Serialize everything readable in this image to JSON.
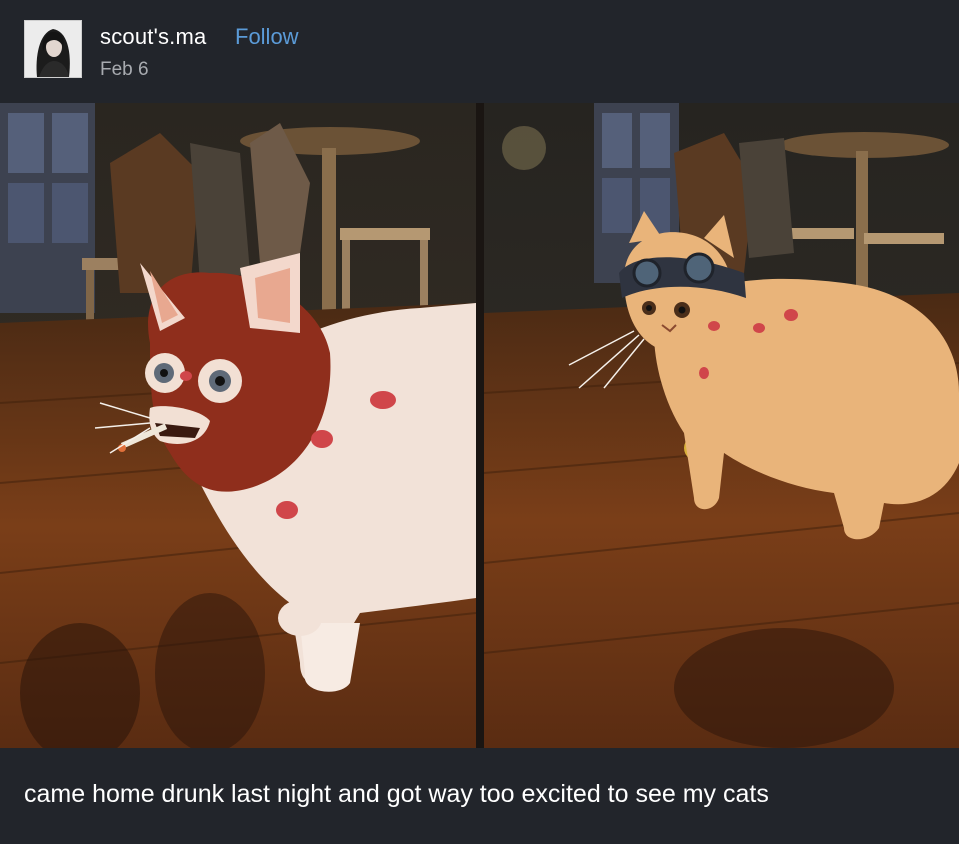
{
  "post": {
    "username": "scout's.ma",
    "follow_label": "Follow",
    "date": "Feb 6",
    "caption": "came home drunk last night and got way too excited to see my cats"
  },
  "colors": {
    "background": "#22252b",
    "follow": "#5b9bd8",
    "date": "#a8abb0",
    "text": "#ffffff"
  },
  "images": [
    {
      "subject": "white cat in red ski mask with cigarette and lipstick kiss marks on wooden floor"
    },
    {
      "subject": "orange cat wearing goggles with lipstick kiss marks on wooden floor"
    }
  ]
}
